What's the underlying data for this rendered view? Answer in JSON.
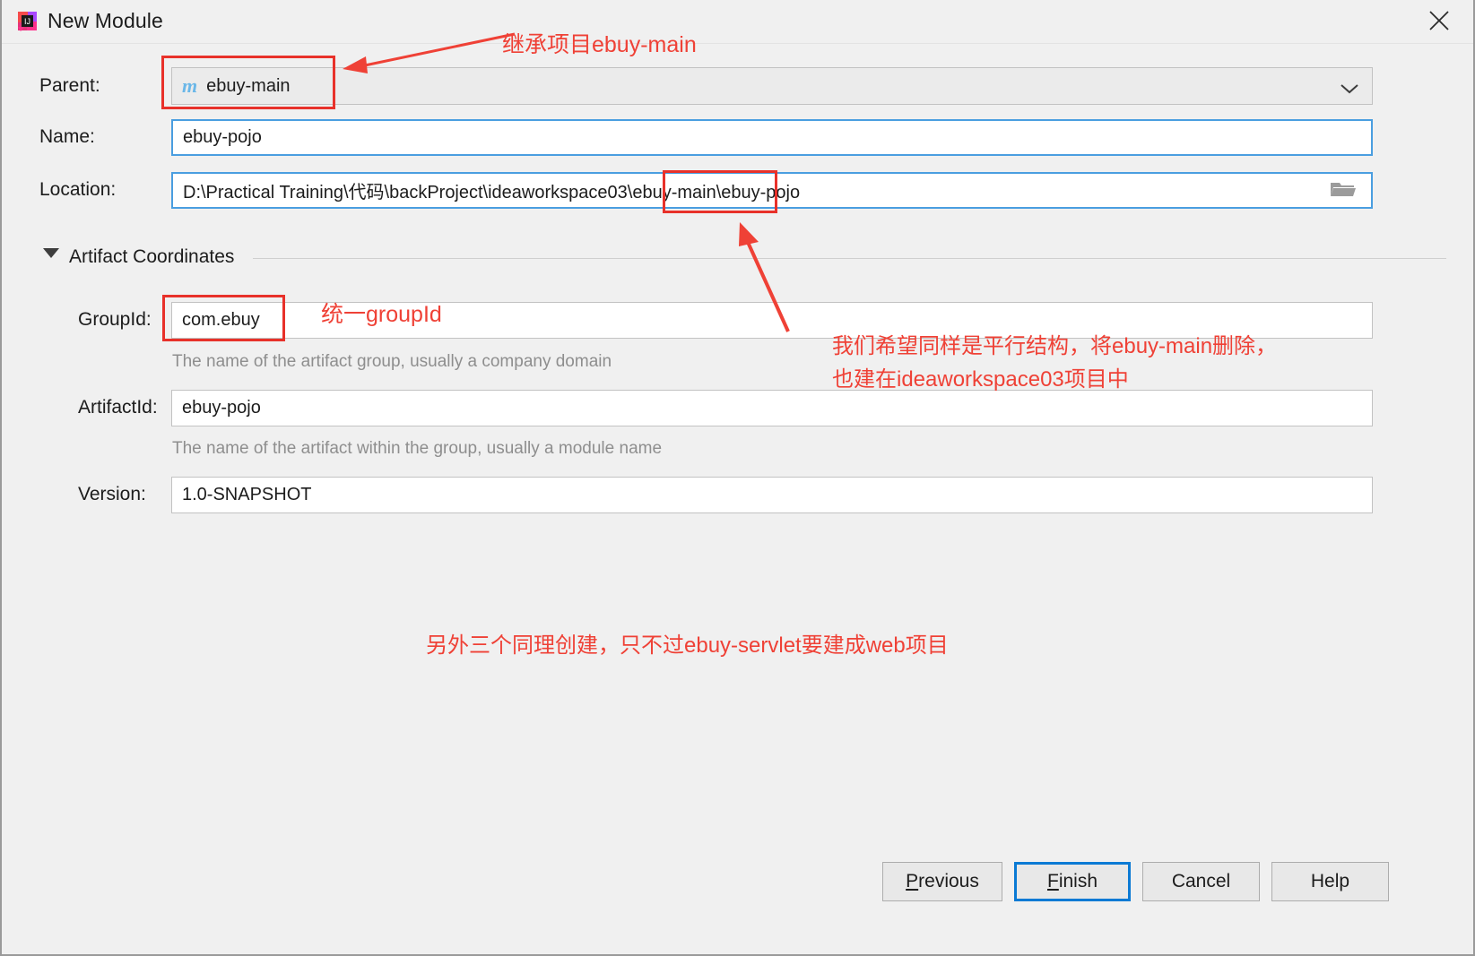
{
  "window": {
    "title": "New Module",
    "icon": "intellij-idea-icon",
    "close_icon": "close-icon"
  },
  "form": {
    "parent": {
      "label": "Parent:",
      "value": "ebuy-main",
      "icon": "maven-module-icon",
      "dropdown_icon": "chevron-down-icon"
    },
    "name": {
      "label": "Name:",
      "value": "ebuy-pojo"
    },
    "location": {
      "label": "Location:",
      "value": "D:\\Practical Training\\代码\\backProject\\ideaworkspace03\\ebuy-main\\ebuy-pojo",
      "browse_icon": "folder-icon"
    }
  },
  "artifact_section": {
    "title": "Artifact Coordinates",
    "collapse_icon": "triangle-down-icon",
    "group_id": {
      "label": "GroupId:",
      "value": "com.ebuy",
      "helper": "The name of the artifact group, usually a company domain"
    },
    "artifact_id": {
      "label": "ArtifactId:",
      "value": "ebuy-pojo",
      "helper": "The name of the artifact within the group, usually a module name"
    },
    "version": {
      "label": "Version:",
      "value": "1.0-SNAPSHOT"
    }
  },
  "annotations": {
    "parent_note": "继承项目ebuy-main",
    "group_note": "统一groupId",
    "location_note_line1": "我们希望同样是平行结构，将ebuy-main删除，",
    "location_note_line2": "也建在ideaworkspace03项目中",
    "bottom_note": "另外三个同理创建，只不过ebuy-servlet要建成web项目",
    "color": "#ef4136"
  },
  "buttons": {
    "previous": "Previous",
    "previous_mnemonic": "P",
    "previous_rest": "revious",
    "finish": "Finish",
    "finish_mnemonic": "F",
    "finish_rest": "inish",
    "cancel": "Cancel",
    "help": "Help"
  }
}
